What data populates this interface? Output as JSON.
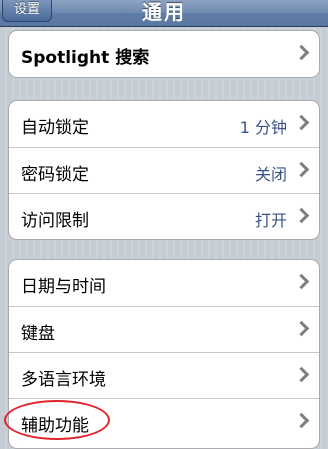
{
  "navbar": {
    "back_label": "设置",
    "title": "通用"
  },
  "groups": [
    {
      "rows": [
        {
          "label": "Spotlight 搜索",
          "value": ""
        }
      ]
    },
    {
      "rows": [
        {
          "label": "自动锁定",
          "value": "1 分钟"
        },
        {
          "label": "密码锁定",
          "value": "关闭"
        },
        {
          "label": "访问限制",
          "value": "打开"
        }
      ]
    },
    {
      "rows": [
        {
          "label": "日期与时间",
          "value": ""
        },
        {
          "label": "键盘",
          "value": ""
        },
        {
          "label": "多语言环境",
          "value": ""
        },
        {
          "label": "辅助功能",
          "value": ""
        }
      ]
    }
  ],
  "colors": {
    "value_text": "#385487",
    "annotation": "#e0242a"
  }
}
